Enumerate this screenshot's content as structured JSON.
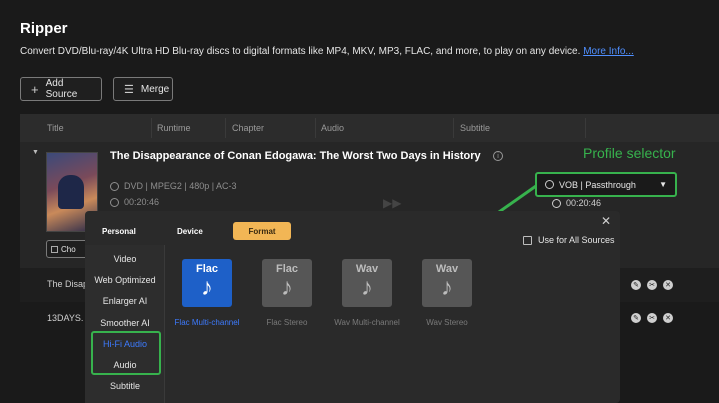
{
  "app": {
    "title": "Ripper",
    "description": "Convert DVD/Blu-ray/4K Ultra HD Blu-ray discs to digital formats like MP4, MKV, MP3, FLAC, and more, to play on any device.",
    "more_info": "More Info..."
  },
  "toolbar": {
    "add_source": "Add Source",
    "merge": "Merge"
  },
  "table": {
    "columns": [
      "Title",
      "Runtime",
      "Chapter",
      "Audio",
      "Subtitle"
    ]
  },
  "movie": {
    "title": "The Disappearance of Conan Edogawa: The Worst Two Days in History",
    "meta": "DVD | MPEG2 | 480p | AC-3",
    "duration": "00:20:46",
    "profile_value": "VOB | Passthrough",
    "output_duration": "00:20:46",
    "choose_label": "Cho"
  },
  "annotation": {
    "label": "Profile selector",
    "color": "#37b24d"
  },
  "rows": [
    {
      "title": "The Disap"
    },
    {
      "title": "13DAYS."
    }
  ],
  "panel": {
    "tabs": [
      "Personal",
      "Device",
      "Format"
    ],
    "use_for_all": "Use for All Sources",
    "categories": [
      "Video",
      "Web Optimized",
      "Enlarger AI",
      "Smoother AI",
      "Hi-Fi Audio",
      "Audio",
      "Subtitle"
    ],
    "active_category": "Hi-Fi Audio",
    "formats": [
      {
        "name": "Flac",
        "label": "Flac Multi-channel",
        "selected": true
      },
      {
        "name": "Flac",
        "label": "Flac Stereo",
        "selected": false
      },
      {
        "name": "Wav",
        "label": "Wav Multi-channel",
        "selected": false
      },
      {
        "name": "Wav",
        "label": "Wav Stereo",
        "selected": false
      }
    ]
  },
  "icons": {
    "add": "plus-icon",
    "merge": "merge-icon",
    "info": "info-icon",
    "disc": "disc-icon",
    "clock": "clock-icon",
    "dropdown": "chevron-down-icon",
    "close": "close-icon",
    "note": "music-note-icon"
  }
}
